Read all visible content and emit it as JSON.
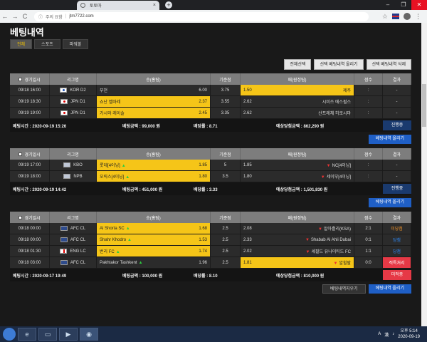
{
  "browser": {
    "tab_title": "토토마",
    "tab_close": "×",
    "new_tab": "+",
    "win_min": "–",
    "win_max": "❐",
    "win_close": "✕",
    "back": "←",
    "forward": "→",
    "reload": "C",
    "security_text": "주의 요함",
    "url": "jtm7722.com",
    "star": "☆",
    "menu": "⋮"
  },
  "page": {
    "title": "베팅내역",
    "filters": [
      {
        "label": "전체"
      },
      {
        "label": "스포츠"
      },
      {
        "label": "파워볼"
      }
    ],
    "actions": [
      "전체선택",
      "선택 베팅내역 올리기",
      "선택 베팅내역 삭제"
    ]
  },
  "table_headers": [
    "경기일시",
    "리그명",
    "승(홈팀)",
    "기준점",
    "패(원정팀)",
    "점수",
    "결과"
  ],
  "bets": [
    {
      "rows": [
        {
          "date": "09/18 16:00",
          "league": "KOR D2",
          "flag": "kr",
          "home": "부천",
          "home_odds": "6.00",
          "home_sel": false,
          "home_arrow": "",
          "line": "3.75",
          "away": "제주",
          "away_odds": "1.50",
          "away_sel": true,
          "away_arrow": "",
          "score": ":",
          "result": "-",
          "result_style": ""
        },
        {
          "date": "09/19 18:30",
          "league": "JPN D1",
          "flag": "jp",
          "home": "쇼난 벨마레",
          "home_odds": "2.37",
          "home_sel": true,
          "home_arrow": "",
          "line": "3.55",
          "away": "시미즈 에스펄스",
          "away_odds": "2.62",
          "away_sel": false,
          "away_arrow": "",
          "score": ":",
          "result": "-",
          "result_style": ""
        },
        {
          "date": "09/19 19:00",
          "league": "JPN D1",
          "flag": "jp",
          "home": "가시와 레이솔",
          "home_odds": "2.45",
          "home_sel": true,
          "home_arrow": "",
          "line": "3.35",
          "away": "산프레체 히로시마",
          "away_odds": "2.62",
          "away_sel": false,
          "away_arrow": "",
          "score": ":",
          "result": "-",
          "result_style": ""
        }
      ],
      "summary": {
        "time": "베팅시간 : 2020-09-19 15:26",
        "amount": "베팅금액 : 99,000 원",
        "odds": "배당률 : 8.71",
        "expected": "예상당첨금액 : 862,290 원",
        "status": "진행중",
        "status_style": ""
      },
      "buttons": [
        "베팅내역 올리기"
      ]
    },
    {
      "rows": [
        {
          "date": "09/19 17:00",
          "league": "KBO",
          "flag": "baseball",
          "home": "롯데[4이닝]",
          "home_odds": "1.85",
          "home_sel": true,
          "home_arrow": "▲",
          "line": "5",
          "away": "NC[4이닝]",
          "away_odds": "1.85",
          "away_sel": false,
          "away_arrow": "▼",
          "score": ":",
          "result": "-",
          "result_style": ""
        },
        {
          "date": "09/19 18:00",
          "league": "NPB",
          "flag": "baseball",
          "home": "오릭스[4이닝]",
          "home_odds": "1.80",
          "home_sel": true,
          "home_arrow": "▲",
          "line": "3.5",
          "away": "세이부[4이닝]",
          "away_odds": "1.80",
          "away_sel": false,
          "away_arrow": "▼",
          "score": ":",
          "result": "-",
          "result_style": ""
        }
      ],
      "summary": {
        "time": "베팅시간 : 2020-09-19 14:42",
        "amount": "베팅금액 : 451,000 원",
        "odds": "배당률 : 3.33",
        "expected": "예상당첨금액 : 1,501,830 원",
        "status": "진행중",
        "status_style": ""
      },
      "buttons": [
        "베팅내역 올리기"
      ]
    },
    {
      "rows": [
        {
          "date": "09/18 00:00",
          "league": "AFC CL",
          "flag": "afc",
          "home": "Al Shorta SC",
          "home_odds": "1.68",
          "home_sel": true,
          "home_arrow": "▲",
          "line": "2.5",
          "away": "알아흘리(KSA)",
          "away_odds": "2.08",
          "away_sel": false,
          "away_arrow": "▼",
          "score": "2:1",
          "result": "미당첨",
          "result_style": "orange"
        },
        {
          "date": "09/18 00:00",
          "league": "AFC CL",
          "flag": "afc",
          "home": "Shahr Khodro",
          "home_odds": "1.53",
          "home_sel": true,
          "home_arrow": "▲",
          "line": "2.5",
          "away": "Shabab Al Ahli Dubai",
          "away_odds": "2.33",
          "away_sel": false,
          "away_arrow": "▼",
          "score": "0:1",
          "result": "당첨",
          "result_style": "blue"
        },
        {
          "date": "09/18 01:30",
          "league": "ENG LC",
          "flag": "en",
          "home": "번리 FC",
          "home_odds": "1.74",
          "home_sel": true,
          "home_arrow": "▲",
          "line": "2.5",
          "away": "셰필드 유나이티드 FC",
          "away_odds": "2.02",
          "away_sel": false,
          "away_arrow": "▼",
          "score": "1:1",
          "result": "당첨",
          "result_style": "blue"
        },
        {
          "date": "09/18 03:00",
          "league": "AFC CL",
          "flag": "afc",
          "home": "Pakhtakor Tashkent",
          "home_odds": "1.96",
          "home_sel": false,
          "home_arrow": "▲",
          "line": "2.5",
          "away": "알힐랄",
          "away_odds": "1.81",
          "away_sel": true,
          "away_arrow": "▼",
          "score": "0:0",
          "result": "적특처리",
          "result_style": "cancel"
        }
      ],
      "summary": {
        "time": "베팅시간 : 2020-09-17 19:49",
        "amount": "베팅금액 : 100,000 원",
        "odds": "배당률 : 8.10",
        "expected": "예상당첨금액 : 810,000 원",
        "status": "미적중",
        "status_style": "cancel"
      },
      "buttons": [
        "베팅내역지우기",
        "베팅내역 올리기"
      ]
    }
  ],
  "taskbar": {
    "tray_lang": "A",
    "tray_ime": "漢",
    "time": "오후 5:14",
    "date": "2020-09-19"
  },
  "colors": {
    "selected_odds": "#f5c518",
    "upload_button": "#1f5fc6",
    "win_result": "#2d8cff",
    "lose_result": "#f0932b",
    "cancel_result": "#e63946"
  }
}
